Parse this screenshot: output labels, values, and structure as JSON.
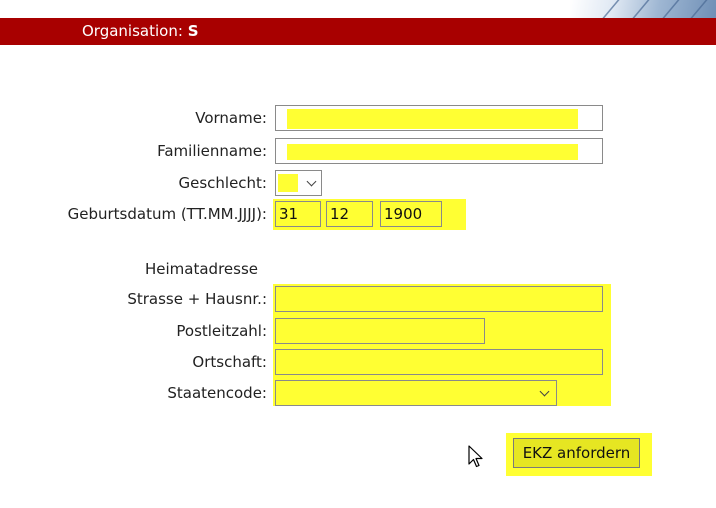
{
  "header": {
    "org_label": "Organisation:",
    "org_value": "S"
  },
  "form": {
    "vorname_label": "Vorname:",
    "familienname_label": "Familienname:",
    "geschlecht_label": "Geschlecht:",
    "geburtsdatum_label": "Geburtsdatum (TT.MM.JJJJ):",
    "birth_day": "31",
    "birth_month": "12",
    "birth_year": "1900",
    "heimatadresse_heading": "Heimatadresse",
    "strasse_label": "Strasse + Hausnr.:",
    "plz_label": "Postleitzahl:",
    "ortschaft_label": "Ortschaft:",
    "staatencode_label": "Staatencode:",
    "submit_label": "EKZ anfordern"
  },
  "colors": {
    "header_red": "#a80000",
    "highlight_yellow": "#ffff33",
    "button_yellow": "#e6e622"
  }
}
